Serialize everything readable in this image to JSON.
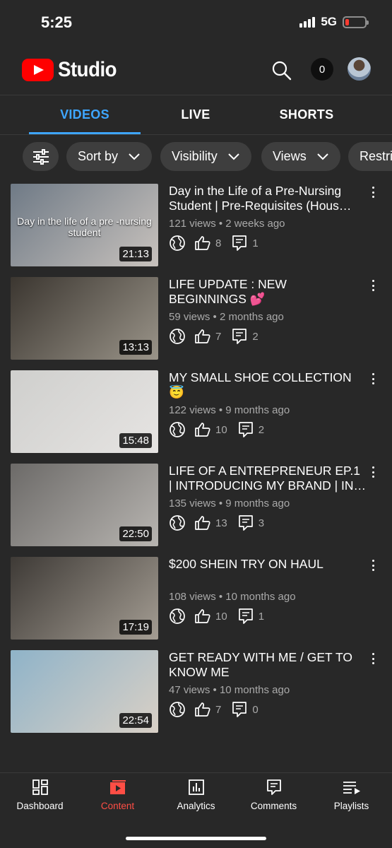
{
  "status_bar": {
    "time": "5:25",
    "network": "5G"
  },
  "header": {
    "logo_text": "Studio",
    "notification_count": "0"
  },
  "tabs": [
    {
      "label": "VIDEOS",
      "active": true
    },
    {
      "label": "LIVE",
      "active": false
    },
    {
      "label": "SHORTS",
      "active": false
    }
  ],
  "filters": {
    "sort": "Sort by",
    "visibility": "Visibility",
    "views": "Views",
    "restrictions": "Restrictions"
  },
  "videos": [
    {
      "title": "Day in the Life of a Pre-Nursing Student | Pre-Requisites (Hous…",
      "views": "121 views",
      "age": "2 weeks ago",
      "likes": "8",
      "comments": "1",
      "duration": "21:13",
      "thumb_caption": "Day in the life of a pre -nursing student",
      "thumb_colors": [
        "#6f7a86",
        "#c8c2bd"
      ]
    },
    {
      "title": "LIFE UPDATE : NEW BEGINNINGS 💕",
      "views": "59 views",
      "age": "2 months ago",
      "likes": "7",
      "comments": "2",
      "duration": "13:13",
      "thumb_caption": "",
      "thumb_colors": [
        "#3b3630",
        "#9a9489"
      ]
    },
    {
      "title": "MY SMALL SHOE COLLECTION 😇",
      "views": "122 views",
      "age": "9 months ago",
      "likes": "10",
      "comments": "2",
      "duration": "15:48",
      "thumb_caption": "",
      "thumb_colors": [
        "#cfcfcd",
        "#e6e4e2"
      ]
    },
    {
      "title": "LIFE OF A ENTREPRENEUR EP.1 | INTRODUCING MY BRAND | IN…",
      "views": "135 views",
      "age": "9 months ago",
      "likes": "13",
      "comments": "3",
      "duration": "22:50",
      "thumb_caption": "",
      "thumb_colors": [
        "#6c6a68",
        "#b8b5b1"
      ]
    },
    {
      "title": "$200 SHEIN TRY ON HAUL",
      "views": "108 views",
      "age": "10 months ago",
      "likes": "10",
      "comments": "1",
      "duration": "17:19",
      "thumb_caption": "",
      "thumb_colors": [
        "#3e3a36",
        "#a49d93"
      ]
    },
    {
      "title": "GET READY WITH ME / GET TO KNOW ME",
      "views": "47 views",
      "age": "10 months ago",
      "likes": "7",
      "comments": "0",
      "duration": "22:54",
      "thumb_caption": "",
      "thumb_colors": [
        "#8fb3c8",
        "#d9d0c6"
      ]
    }
  ],
  "bottom_nav": [
    {
      "label": "Dashboard",
      "icon": "dashboard-icon",
      "active": false
    },
    {
      "label": "Content",
      "icon": "content-icon",
      "active": true
    },
    {
      "label": "Analytics",
      "icon": "analytics-icon",
      "active": false
    },
    {
      "label": "Comments",
      "icon": "comments-icon",
      "active": false
    },
    {
      "label": "Playlists",
      "icon": "playlists-icon",
      "active": false
    }
  ],
  "colors": {
    "background": "#282828",
    "accent": "#3ea6ff",
    "brand_red": "#ff0000",
    "nav_active": "#ff4e45"
  }
}
